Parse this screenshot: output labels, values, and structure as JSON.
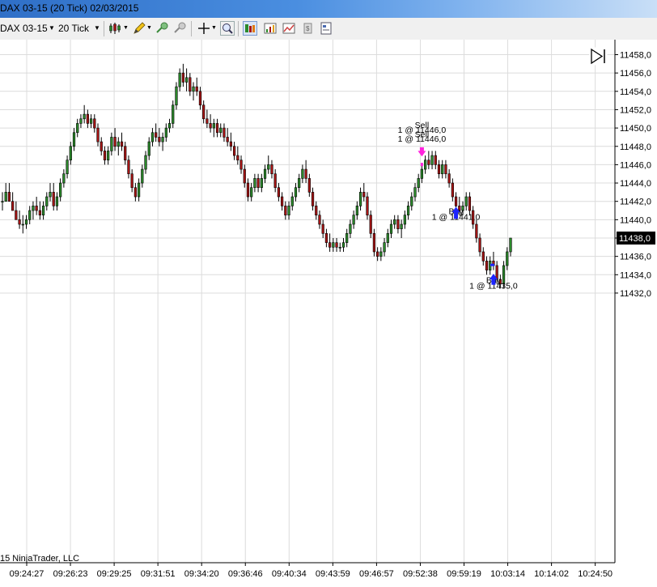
{
  "window": {
    "title": "DAX 03-15 (20 Tick)  02/03/2015"
  },
  "toolbar": {
    "instrument": "DAX 03-15",
    "interval": "20 Tick",
    "icons": [
      "bar-type-icon",
      "drawing-pencil-icon",
      "indicator-icon",
      "strategy-icon",
      "crosshair-icon",
      "zoom-icon",
      "chart-trader-icon",
      "chart-properties-icon",
      "data-box-icon",
      "templates-icon"
    ]
  },
  "chart_data": {
    "type": "candlestick",
    "title": "",
    "xlabel": "",
    "ylabel": "",
    "ylim": [
      11431.0,
      11459.2
    ],
    "grid": true,
    "y_ticks": [
      "11458,0",
      "11456,0",
      "11454,0",
      "11452,0",
      "11450,0",
      "11448,0",
      "11446,0",
      "11444,0",
      "11442,0",
      "11440,0",
      "11438,0",
      "11436,0",
      "11434,0",
      "11432,0"
    ],
    "x_ticks": [
      "09:24:27",
      "09:26:23",
      "09:29:25",
      "09:31:51",
      "09:34:20",
      "09:36:46",
      "09:40:34",
      "09:43:59",
      "09:46:57",
      "09:52:38",
      "09:59:19",
      "10:03:14",
      "10:14:02",
      "10:24:50"
    ],
    "last_price": "11438,0",
    "colors": {
      "up": "#2b8a2b",
      "down": "#a81414",
      "wick": "#000000",
      "grid": "#dcdcdc",
      "last_price_bg": "#000000",
      "sell_arrow": "#ff22dd",
      "buy_arrow": "#1d24ff"
    },
    "copyright": "15 NinjaTrader, LLC",
    "trade_labels": [
      {
        "side": "Sell",
        "detail": "1 @ 11446,0"
      },
      {
        "side": "Sell",
        "detail": "1 @ 11446,0"
      },
      {
        "side": "Buy",
        "detail": "1 @ 11441,0"
      },
      {
        "side": "Buy",
        "detail": "1 @ 11435,0"
      }
    ],
    "candles": [
      {
        "o": 11442,
        "h": 11443,
        "l": 11441,
        "c": 11442
      },
      {
        "o": 11442,
        "h": 11444,
        "l": 11442,
        "c": 11443
      },
      {
        "o": 11443,
        "h": 11444,
        "l": 11442,
        "c": 11442
      },
      {
        "o": 11442,
        "h": 11443,
        "l": 11441,
        "c": 11441
      },
      {
        "o": 11441,
        "h": 11442,
        "l": 11440,
        "c": 11440
      },
      {
        "o": 11440,
        "h": 11441,
        "l": 11439,
        "c": 11439.5
      },
      {
        "o": 11439.5,
        "h": 11440.5,
        "l": 11438.5,
        "c": 11439.5
      },
      {
        "o": 11439.5,
        "h": 11440.5,
        "l": 11439,
        "c": 11440
      },
      {
        "o": 11440,
        "h": 11441.5,
        "l": 11439.5,
        "c": 11441
      },
      {
        "o": 11441,
        "h": 11442,
        "l": 11440,
        "c": 11441.5
      },
      {
        "o": 11441.5,
        "h": 11442.5,
        "l": 11440.5,
        "c": 11441
      },
      {
        "o": 11441,
        "h": 11442,
        "l": 11440,
        "c": 11440.5
      },
      {
        "o": 11440.5,
        "h": 11442,
        "l": 11440,
        "c": 11441.5
      },
      {
        "o": 11441.5,
        "h": 11443,
        "l": 11441,
        "c": 11442.5
      },
      {
        "o": 11442.5,
        "h": 11444,
        "l": 11442,
        "c": 11443
      },
      {
        "o": 11443,
        "h": 11444,
        "l": 11441,
        "c": 11441.5
      },
      {
        "o": 11441.5,
        "h": 11443,
        "l": 11441,
        "c": 11442.5
      },
      {
        "o": 11442.5,
        "h": 11444.5,
        "l": 11442,
        "c": 11444
      },
      {
        "o": 11444,
        "h": 11445.5,
        "l": 11443.5,
        "c": 11445
      },
      {
        "o": 11445,
        "h": 11447,
        "l": 11444.5,
        "c": 11446.5
      },
      {
        "o": 11446.5,
        "h": 11448.5,
        "l": 11446,
        "c": 11448
      },
      {
        "o": 11448,
        "h": 11450,
        "l": 11447.5,
        "c": 11449.5
      },
      {
        "o": 11449.5,
        "h": 11451,
        "l": 11449,
        "c": 11450.5
      },
      {
        "o": 11450.5,
        "h": 11451.5,
        "l": 11450,
        "c": 11451
      },
      {
        "o": 11451,
        "h": 11452.5,
        "l": 11450.5,
        "c": 11451.5
      },
      {
        "o": 11451.5,
        "h": 11452,
        "l": 11450,
        "c": 11450.5
      },
      {
        "o": 11450.5,
        "h": 11451.5,
        "l": 11450,
        "c": 11451
      },
      {
        "o": 11451,
        "h": 11451.5,
        "l": 11449.5,
        "c": 11450
      },
      {
        "o": 11450,
        "h": 11450.5,
        "l": 11448,
        "c": 11448.5
      },
      {
        "o": 11448.5,
        "h": 11449,
        "l": 11447,
        "c": 11447.5
      },
      {
        "o": 11447.5,
        "h": 11448,
        "l": 11446,
        "c": 11446.5
      },
      {
        "o": 11446.5,
        "h": 11448,
        "l": 11446,
        "c": 11447.5
      },
      {
        "o": 11447.5,
        "h": 11449.5,
        "l": 11447,
        "c": 11449
      },
      {
        "o": 11449,
        "h": 11450,
        "l": 11447.5,
        "c": 11448
      },
      {
        "o": 11448,
        "h": 11449,
        "l": 11447,
        "c": 11448.5
      },
      {
        "o": 11448.5,
        "h": 11449.5,
        "l": 11447.5,
        "c": 11448
      },
      {
        "o": 11448,
        "h": 11448.5,
        "l": 11446,
        "c": 11446.5
      },
      {
        "o": 11446.5,
        "h": 11447,
        "l": 11444.5,
        "c": 11445
      },
      {
        "o": 11445,
        "h": 11445.5,
        "l": 11443,
        "c": 11443.5
      },
      {
        "o": 11443.5,
        "h": 11444,
        "l": 11442,
        "c": 11442.5
      },
      {
        "o": 11442.5,
        "h": 11444.5,
        "l": 11442,
        "c": 11444
      },
      {
        "o": 11444,
        "h": 11446,
        "l": 11443.5,
        "c": 11445.5
      },
      {
        "o": 11445.5,
        "h": 11447.5,
        "l": 11445,
        "c": 11447
      },
      {
        "o": 11447,
        "h": 11449,
        "l": 11446.5,
        "c": 11448.5
      },
      {
        "o": 11448.5,
        "h": 11450,
        "l": 11448,
        "c": 11449.5
      },
      {
        "o": 11449.5,
        "h": 11450.5,
        "l": 11448.5,
        "c": 11449
      },
      {
        "o": 11449,
        "h": 11450,
        "l": 11448,
        "c": 11448.5
      },
      {
        "o": 11448.5,
        "h": 11449.5,
        "l": 11447.5,
        "c": 11449
      },
      {
        "o": 11449,
        "h": 11450.5,
        "l": 11448.5,
        "c": 11450
      },
      {
        "o": 11450,
        "h": 11451,
        "l": 11449.5,
        "c": 11450.5
      },
      {
        "o": 11450.5,
        "h": 11453,
        "l": 11450,
        "c": 11452.5
      },
      {
        "o": 11452.5,
        "h": 11455,
        "l": 11452,
        "c": 11454.5
      },
      {
        "o": 11454.5,
        "h": 11456.5,
        "l": 11454,
        "c": 11456
      },
      {
        "o": 11456,
        "h": 11457,
        "l": 11454.5,
        "c": 11455
      },
      {
        "o": 11455,
        "h": 11456.5,
        "l": 11454,
        "c": 11455.5
      },
      {
        "o": 11455.5,
        "h": 11456,
        "l": 11453.5,
        "c": 11454
      },
      {
        "o": 11454,
        "h": 11455,
        "l": 11453,
        "c": 11454.5
      },
      {
        "o": 11454.5,
        "h": 11455.5,
        "l": 11453.5,
        "c": 11454
      },
      {
        "o": 11454,
        "h": 11454.5,
        "l": 11452,
        "c": 11452.5
      },
      {
        "o": 11452.5,
        "h": 11453,
        "l": 11450.5,
        "c": 11451
      },
      {
        "o": 11451,
        "h": 11452,
        "l": 11450,
        "c": 11450.5
      },
      {
        "o": 11450.5,
        "h": 11451.5,
        "l": 11449.5,
        "c": 11450
      },
      {
        "o": 11450,
        "h": 11451,
        "l": 11449,
        "c": 11450.5
      },
      {
        "o": 11450.5,
        "h": 11451,
        "l": 11449,
        "c": 11449.5
      },
      {
        "o": 11449.5,
        "h": 11450.5,
        "l": 11449,
        "c": 11450
      },
      {
        "o": 11450,
        "h": 11450.5,
        "l": 11448.5,
        "c": 11449
      },
      {
        "o": 11449,
        "h": 11450,
        "l": 11448,
        "c": 11448.5
      },
      {
        "o": 11448.5,
        "h": 11449.5,
        "l": 11447.5,
        "c": 11448
      },
      {
        "o": 11448,
        "h": 11448.5,
        "l": 11446.5,
        "c": 11447
      },
      {
        "o": 11447,
        "h": 11448,
        "l": 11446,
        "c": 11446.5
      },
      {
        "o": 11446.5,
        "h": 11447,
        "l": 11445,
        "c": 11445.5
      },
      {
        "o": 11445.5,
        "h": 11446,
        "l": 11443.5,
        "c": 11444
      },
      {
        "o": 11444,
        "h": 11444.5,
        "l": 11442,
        "c": 11442.5
      },
      {
        "o": 11442.5,
        "h": 11444,
        "l": 11442,
        "c": 11443.5
      },
      {
        "o": 11443.5,
        "h": 11445,
        "l": 11443,
        "c": 11444.5
      },
      {
        "o": 11444.5,
        "h": 11445,
        "l": 11443,
        "c": 11443.5
      },
      {
        "o": 11443.5,
        "h": 11445,
        "l": 11443,
        "c": 11444.5
      },
      {
        "o": 11444.5,
        "h": 11446,
        "l": 11444,
        "c": 11445.5
      },
      {
        "o": 11445.5,
        "h": 11447,
        "l": 11445,
        "c": 11446
      },
      {
        "o": 11446,
        "h": 11446.5,
        "l": 11444.5,
        "c": 11445
      },
      {
        "o": 11445,
        "h": 11445.5,
        "l": 11443,
        "c": 11443.5
      },
      {
        "o": 11443.5,
        "h": 11444,
        "l": 11442,
        "c": 11442.5
      },
      {
        "o": 11442.5,
        "h": 11443,
        "l": 11441,
        "c": 11441.5
      },
      {
        "o": 11441.5,
        "h": 11442,
        "l": 11440,
        "c": 11440.5
      },
      {
        "o": 11440.5,
        "h": 11442,
        "l": 11440,
        "c": 11441.5
      },
      {
        "o": 11441.5,
        "h": 11443,
        "l": 11441,
        "c": 11442.5
      },
      {
        "o": 11442.5,
        "h": 11444,
        "l": 11442,
        "c": 11443.5
      },
      {
        "o": 11443.5,
        "h": 11445,
        "l": 11443,
        "c": 11444.5
      },
      {
        "o": 11444.5,
        "h": 11446,
        "l": 11444,
        "c": 11445.5
      },
      {
        "o": 11445.5,
        "h": 11446.5,
        "l": 11444,
        "c": 11444.5
      },
      {
        "o": 11444.5,
        "h": 11445,
        "l": 11442.5,
        "c": 11443
      },
      {
        "o": 11443,
        "h": 11443.5,
        "l": 11441,
        "c": 11441.5
      },
      {
        "o": 11441.5,
        "h": 11442,
        "l": 11440,
        "c": 11440.5
      },
      {
        "o": 11440.5,
        "h": 11441,
        "l": 11439,
        "c": 11439.5
      },
      {
        "o": 11439.5,
        "h": 11440,
        "l": 11438,
        "c": 11438.5
      },
      {
        "o": 11438.5,
        "h": 11439,
        "l": 11437,
        "c": 11437.5
      },
      {
        "o": 11437.5,
        "h": 11438.5,
        "l": 11436.5,
        "c": 11437
      },
      {
        "o": 11437,
        "h": 11438,
        "l": 11436.5,
        "c": 11437.5
      },
      {
        "o": 11437.5,
        "h": 11438,
        "l": 11436.5,
        "c": 11437
      },
      {
        "o": 11437,
        "h": 11437.5,
        "l": 11436.5,
        "c": 11437
      },
      {
        "o": 11437,
        "h": 11438,
        "l": 11436.5,
        "c": 11437.5
      },
      {
        "o": 11437.5,
        "h": 11439,
        "l": 11437,
        "c": 11438.5
      },
      {
        "o": 11438.5,
        "h": 11440,
        "l": 11438,
        "c": 11439.5
      },
      {
        "o": 11439.5,
        "h": 11441,
        "l": 11439,
        "c": 11440.5
      },
      {
        "o": 11440.5,
        "h": 11442,
        "l": 11440,
        "c": 11441.5
      },
      {
        "o": 11441.5,
        "h": 11443.5,
        "l": 11441,
        "c": 11443
      },
      {
        "o": 11443,
        "h": 11444,
        "l": 11442,
        "c": 11442.5
      },
      {
        "o": 11442.5,
        "h": 11443,
        "l": 11440,
        "c": 11440.5
      },
      {
        "o": 11440.5,
        "h": 11441,
        "l": 11438,
        "c": 11438.5
      },
      {
        "o": 11438.5,
        "h": 11439,
        "l": 11436,
        "c": 11436.5
      },
      {
        "o": 11436.5,
        "h": 11437,
        "l": 11435.5,
        "c": 11436
      },
      {
        "o": 11436,
        "h": 11437,
        "l": 11435.5,
        "c": 11436.5
      },
      {
        "o": 11436.5,
        "h": 11438,
        "l": 11436,
        "c": 11437.5
      },
      {
        "o": 11437.5,
        "h": 11439,
        "l": 11437,
        "c": 11438.5
      },
      {
        "o": 11438.5,
        "h": 11440,
        "l": 11438,
        "c": 11439.5
      },
      {
        "o": 11439.5,
        "h": 11440.5,
        "l": 11439,
        "c": 11440
      },
      {
        "o": 11440,
        "h": 11440.5,
        "l": 11438.5,
        "c": 11439
      },
      {
        "o": 11439,
        "h": 11440,
        "l": 11438,
        "c": 11439.5
      },
      {
        "o": 11439.5,
        "h": 11441,
        "l": 11439,
        "c": 11440.5
      },
      {
        "o": 11440.5,
        "h": 11442,
        "l": 11440,
        "c": 11441.5
      },
      {
        "o": 11441.5,
        "h": 11443,
        "l": 11441,
        "c": 11442.5
      },
      {
        "o": 11442.5,
        "h": 11444,
        "l": 11442,
        "c": 11443.5
      },
      {
        "o": 11443.5,
        "h": 11445,
        "l": 11443,
        "c": 11444.5
      },
      {
        "o": 11444.5,
        "h": 11446,
        "l": 11444,
        "c": 11445.5
      },
      {
        "o": 11445.5,
        "h": 11447,
        "l": 11445,
        "c": 11446.5
      },
      {
        "o": 11446.5,
        "h": 11447.5,
        "l": 11445.5,
        "c": 11446
      },
      {
        "o": 11446,
        "h": 11447.5,
        "l": 11445.5,
        "c": 11447
      },
      {
        "o": 11447,
        "h": 11447.5,
        "l": 11445.5,
        "c": 11446
      },
      {
        "o": 11446,
        "h": 11446.5,
        "l": 11444.5,
        "c": 11445
      },
      {
        "o": 11445,
        "h": 11446.5,
        "l": 11444.5,
        "c": 11446
      },
      {
        "o": 11446,
        "h": 11446.5,
        "l": 11444.5,
        "c": 11445
      },
      {
        "o": 11445,
        "h": 11445.5,
        "l": 11443.5,
        "c": 11444
      },
      {
        "o": 11444,
        "h": 11444.5,
        "l": 11442,
        "c": 11442.5
      },
      {
        "o": 11442.5,
        "h": 11443,
        "l": 11441,
        "c": 11441.5
      },
      {
        "o": 11441.5,
        "h": 11442.5,
        "l": 11440.5,
        "c": 11441
      },
      {
        "o": 11441,
        "h": 11442,
        "l": 11440.5,
        "c": 11441.5
      },
      {
        "o": 11441.5,
        "h": 11443,
        "l": 11441,
        "c": 11442.5
      },
      {
        "o": 11442.5,
        "h": 11443,
        "l": 11440.5,
        "c": 11441
      },
      {
        "o": 11441,
        "h": 11441.5,
        "l": 11439,
        "c": 11439.5
      },
      {
        "o": 11439.5,
        "h": 11440,
        "l": 11437.5,
        "c": 11438
      },
      {
        "o": 11438,
        "h": 11438.5,
        "l": 11436,
        "c": 11436.5
      },
      {
        "o": 11436.5,
        "h": 11437,
        "l": 11435,
        "c": 11435.5
      },
      {
        "o": 11435.5,
        "h": 11436,
        "l": 11434,
        "c": 11434.5
      },
      {
        "o": 11434.5,
        "h": 11436,
        "l": 11434,
        "c": 11435.5
      },
      {
        "o": 11435.5,
        "h": 11436.5,
        "l": 11434.5,
        "c": 11435
      },
      {
        "o": 11435,
        "h": 11435.5,
        "l": 11433,
        "c": 11433.5
      },
      {
        "o": 11433.5,
        "h": 11434,
        "l": 11432.5,
        "c": 11433
      },
      {
        "o": 11433,
        "h": 11435.5,
        "l": 11432.5,
        "c": 11435
      },
      {
        "o": 11435,
        "h": 11437,
        "l": 11434.5,
        "c": 11436.5
      },
      {
        "o": 11436.5,
        "h": 11438,
        "l": 11436,
        "c": 11438
      }
    ]
  }
}
